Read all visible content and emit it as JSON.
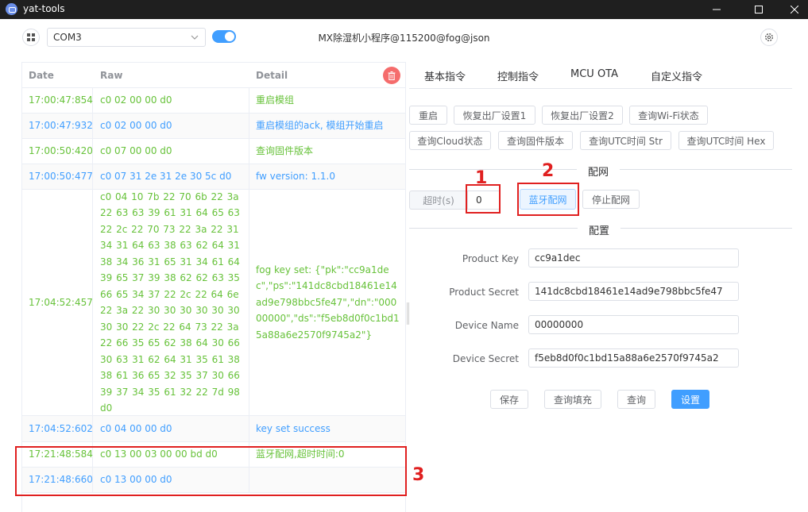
{
  "window": {
    "title": "yat-tools"
  },
  "toolbar": {
    "port": "COM3",
    "device_title": "MX除湿机小程序@115200@fog@json"
  },
  "log": {
    "headers": {
      "date": "Date",
      "raw": "Raw",
      "detail": "Detail"
    },
    "rows": [
      {
        "date": "17:00:47:854",
        "raw": "c0 02 00 00 d0",
        "detail": "重启模组"
      },
      {
        "date": "17:00:47:932",
        "raw": "c0 02 00 00 d0",
        "detail": "重启模组的ack, 模组开始重启"
      },
      {
        "date": "17:00:50:420",
        "raw": "c0 07 00 00 d0",
        "detail": "查询固件版本"
      },
      {
        "date": "17:00:50:477",
        "raw": "c0 07 31 2e 31 2e 30 5c d0",
        "detail": "fw version: 1.1.0"
      },
      {
        "date": "17:04:52:457",
        "raw": "c0 04 10 7b 22 70 6b 22 3a 22 63 63 39 61 31 64 65 63 22 2c 22 70 73 22 3a 22 31 34 31 64 63 38 63 62 64 31 38 34 36 31 65 31 34 61 64 39 65 37 39 38 62 62 63 35 66 65 34 37 22 2c 22 64 6e 22 3a 22 30 30 30 30 30 30 30 30 22 2c 22 64 73 22 3a 22 66 35 65 62 38 64 30 66 30 63 31 62 64 31 35 61 38 38 61 36 65 32 35 37 30 66 39 37 34 35 61 32 22 7d 98 d0",
        "detail": "fog key set: {\"pk\":\"cc9a1dec\",\"ps\":\"141dc8cbd18461e14ad9e798bbc5fe47\",\"dn\":\"00000000\",\"ds\":\"f5eb8d0f0c1bd15a88a6e2570f9745a2\"}"
      },
      {
        "date": "17:04:52:602",
        "raw": "c0 04 00 00 d0",
        "detail": "key set success"
      },
      {
        "date": "17:21:48:584",
        "raw": "c0 13 00 03 00 00 bd d0",
        "detail": "蓝牙配网,超时时间:0"
      },
      {
        "date": "17:21:48:660",
        "raw": "c0 13 00 00 d0",
        "detail": ""
      }
    ]
  },
  "tabs": [
    "基本指令",
    "控制指令",
    "MCU OTA",
    "自定义指令"
  ],
  "commands": {
    "row1": [
      "重启",
      "恢复出厂设置1",
      "恢复出厂设置2",
      "查询Wi-Fi状态"
    ],
    "row2": [
      "查询Cloud状态",
      "查询固件版本",
      "查询UTC时间 Str",
      "查询UTC时间 Hex"
    ]
  },
  "network": {
    "section_title": "配网",
    "timeout_label": "超时(s)",
    "timeout_value": "0",
    "ble_button": "蓝牙配网",
    "stop_button": "停止配网"
  },
  "config": {
    "section_title": "配置",
    "fields": [
      {
        "label": "Product Key",
        "value": "cc9a1dec"
      },
      {
        "label": "Product Secret",
        "value": "141dc8cbd18461e14ad9e798bbc5fe47"
      },
      {
        "label": "Device Name",
        "value": "00000000"
      },
      {
        "label": "Device Secret",
        "value": "f5eb8d0f0c1bd15a88a6e2570f9745a2"
      }
    ],
    "buttons": [
      "保存",
      "查询填充",
      "查询",
      "设置"
    ]
  },
  "annotations": [
    "1",
    "2",
    "3"
  ]
}
